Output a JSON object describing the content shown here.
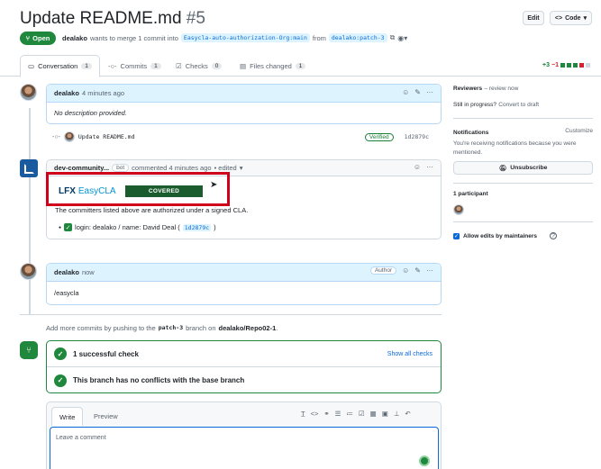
{
  "header": {
    "title": "Update README.md",
    "number": "#5",
    "edit_label": "Edit",
    "code_label": "Code"
  },
  "status": {
    "state": "Open",
    "author": "dealako",
    "action": "wants to merge 1 commit into",
    "base_branch": "Easycla-auto-authorization-Org:main",
    "from": "from",
    "head_branch": "dealako:patch-3"
  },
  "tabs": [
    {
      "label": "Conversation",
      "count": "1"
    },
    {
      "label": "Commits",
      "count": "1"
    },
    {
      "label": "Checks",
      "count": "0"
    },
    {
      "label": "Files changed",
      "count": "1"
    }
  ],
  "diffstat": {
    "added": "+3",
    "removed": "−1"
  },
  "first_comment": {
    "author": "dealako",
    "time": "4 minutes ago",
    "body": "No description provided."
  },
  "commit": {
    "message": "Update README.md",
    "verified": "Verified",
    "sha": "1d2879c"
  },
  "bot_comment": {
    "author": "dev-community...",
    "badge": "bot",
    "action": "commented 4 minutes ago",
    "edited": "• edited",
    "logo_lf": "LFX",
    "logo_easycla": "EasyCLA",
    "covered": "COVERED",
    "text": "The committers listed above are authorized under a signed CLA.",
    "item_prefix": "login: dealako / name: David Deal (",
    "item_sha": "1d2879c",
    "item_suffix": ")"
  },
  "third_comment": {
    "author": "dealako",
    "time": "now",
    "badge": "Author",
    "body": "/easycla"
  },
  "push_hint": {
    "prefix": "Add more commits by pushing to the",
    "branch": "patch-3",
    "middle": "branch on",
    "repo": "dealako/Repo02-1",
    "suffix": "."
  },
  "checks": {
    "successful": "1 successful check",
    "show_all": "Show all checks",
    "no_conflicts": "This branch has no conflicts with the base branch"
  },
  "editor": {
    "write_tab": "Write",
    "preview_tab": "Preview",
    "placeholder": "Leave a comment"
  },
  "sidebar": {
    "reviewers_title": "Reviewers",
    "reviewers_note": "– review now",
    "in_progress": "Still in progress?",
    "convert_draft": "Convert to draft",
    "notifications_title": "Notifications",
    "customize": "Customize",
    "notif_text": "You're receiving notifications because you were mentioned.",
    "unsubscribe": "Unsubscribe",
    "participants": "1 participant",
    "allow_edits": "Allow edits by maintainers"
  },
  "colors": {
    "accent": "#0969da",
    "success": "#1f883d",
    "danger": "#d1242f",
    "highlight_box": "#d0021b"
  }
}
